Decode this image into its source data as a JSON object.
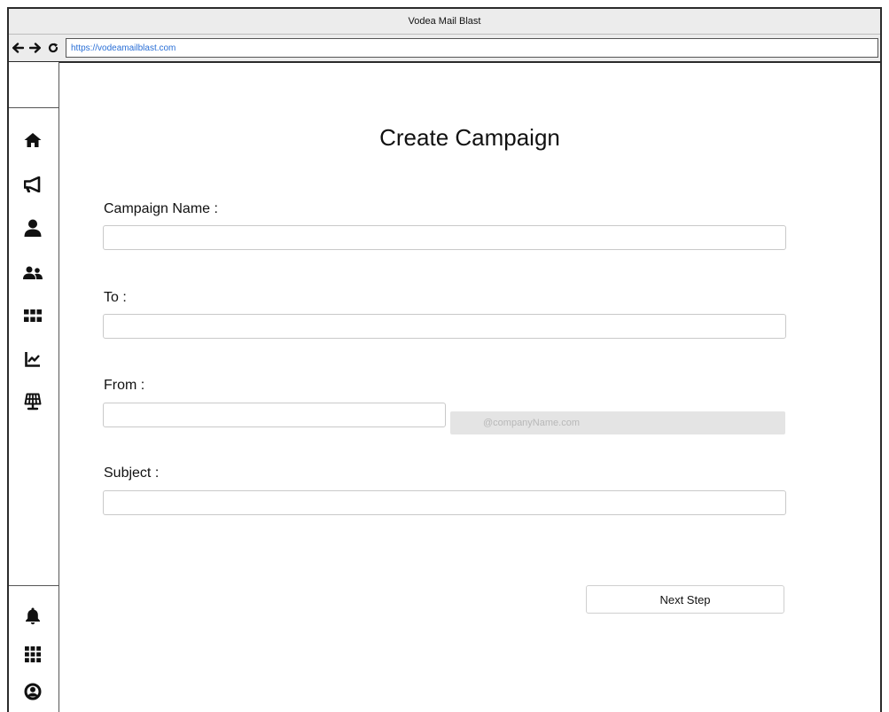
{
  "window": {
    "title": "Vodea Mail Blast"
  },
  "browser": {
    "url": "https://vodeamailblast.com"
  },
  "sidebar": {
    "top_icons": [
      "home-icon",
      "megaphone-icon",
      "user-icon",
      "users-icon",
      "grid-icon",
      "chart-icon",
      "solar-panel-icon"
    ],
    "bottom_icons": [
      "bell-icon",
      "apps-grid-icon",
      "account-circle-icon"
    ]
  },
  "form": {
    "title": "Create Campaign",
    "campaign_name_label": "Campaign Name :",
    "campaign_name_value": "",
    "to_label": "To :",
    "to_value": "",
    "from_label": "From :",
    "from_value": "",
    "from_domain": "@companyName.com",
    "subject_label": "Subject :",
    "subject_value": "",
    "next_label": "Next Step"
  }
}
